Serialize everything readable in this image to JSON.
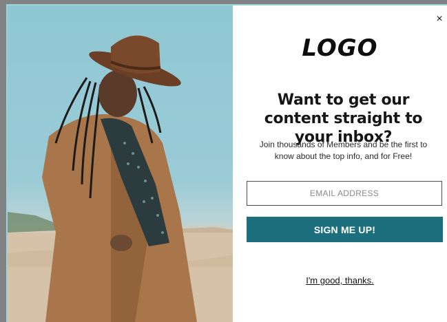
{
  "popup": {
    "logo_text": "LOGO",
    "close_glyph": "×",
    "headline": "Want to get our content straight to your inbox?",
    "subtext": "Join thousands of Members and be the first to know about the top info, and for Free!",
    "email_placeholder": "EMAIL ADDRESS",
    "email_value": "",
    "submit_label": "SIGN ME UP!",
    "decline_label": "I'm good, thanks."
  },
  "colors": {
    "accent_button": "#1e6f7e",
    "backdrop": "#7f8183",
    "modal_background": "#ffffff"
  },
  "icons": {
    "close": "close-icon"
  }
}
